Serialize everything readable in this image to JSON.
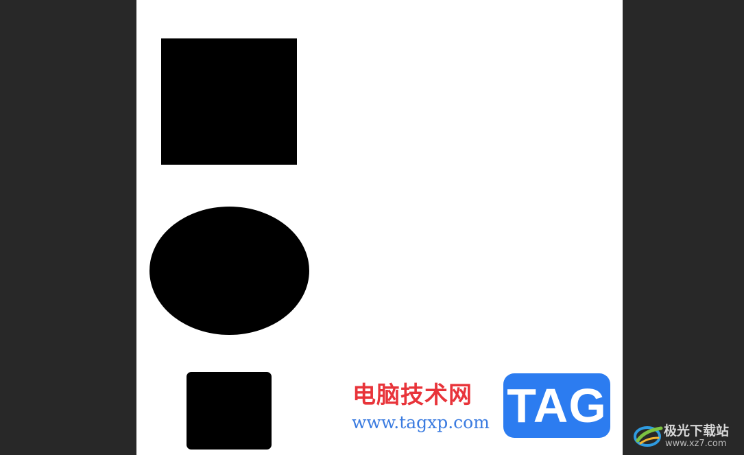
{
  "canvas": {
    "background": "#ffffff",
    "workspace_background": "#282828",
    "shapes": [
      {
        "kind": "rectangle",
        "fill": "#000000"
      },
      {
        "kind": "ellipse",
        "fill": "#000000"
      },
      {
        "kind": "rounded-rectangle",
        "fill": "#000000"
      }
    ]
  },
  "watermark": {
    "site_name": "电脑技术网",
    "site_url": "www.tagxp.com",
    "badge": "TAG",
    "site_name_color": "#e8343a",
    "url_color": "#3a7be0",
    "badge_color": "#2c7cf0"
  },
  "corner_logo": {
    "icon": "xz7-logo-icon",
    "title": "极光下载站",
    "url": "www.xz7.com"
  }
}
